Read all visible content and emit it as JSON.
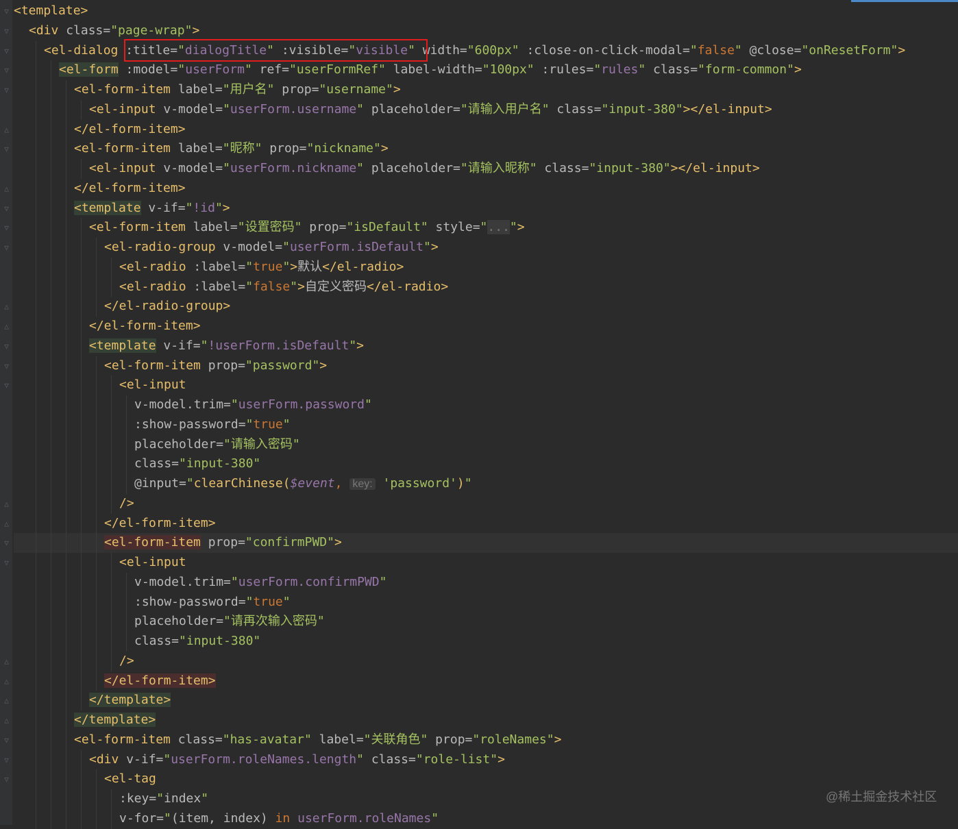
{
  "watermark": "@稀土掘金技术社区",
  "highlight_box_color": "#e01c1c",
  "current_line_index": 27,
  "lines": [
    {
      "indent": 0,
      "fold": "open",
      "tokens": [
        [
          "tag",
          "<template>"
        ]
      ]
    },
    {
      "indent": 1,
      "fold": "open",
      "tokens": [
        [
          "tag",
          "<div "
        ],
        [
          "attr",
          "class="
        ],
        [
          "str",
          "\"page-wrap\""
        ],
        [
          "tag",
          ">"
        ]
      ]
    },
    {
      "indent": 2,
      "fold": "open",
      "tokens": [
        [
          "tag",
          "<el-dialog "
        ],
        [
          "attr",
          ":title="
        ],
        [
          "str",
          "\""
        ],
        [
          "vexp",
          "dialogTitle"
        ],
        [
          "str",
          "\""
        ],
        [
          "attr",
          " :visible="
        ],
        [
          "str",
          "\""
        ],
        [
          "vexp",
          "visible"
        ],
        [
          "str",
          "\""
        ],
        [
          "attr",
          " width="
        ],
        [
          "str",
          "\"600px\""
        ],
        [
          "attr",
          " :close-on-click-modal="
        ],
        [
          "str",
          "\""
        ],
        [
          "kw",
          "false"
        ],
        [
          "str",
          "\""
        ],
        [
          "attr",
          " @close="
        ],
        [
          "str",
          "\"onResetForm\""
        ],
        [
          "tag",
          ">"
        ]
      ]
    },
    {
      "indent": 3,
      "fold": "open",
      "tokens": [
        [
          "tag hl-green",
          "<el-form"
        ],
        [
          "attr",
          " :model="
        ],
        [
          "str",
          "\""
        ],
        [
          "vexp",
          "userForm"
        ],
        [
          "str",
          "\""
        ],
        [
          "attr",
          " ref="
        ],
        [
          "str",
          "\"userFormRef\""
        ],
        [
          "attr",
          " label-width="
        ],
        [
          "str",
          "\"100px\""
        ],
        [
          "attr",
          " :rules="
        ],
        [
          "str",
          "\""
        ],
        [
          "vexp",
          "rules"
        ],
        [
          "str",
          "\""
        ],
        [
          "attr",
          " class="
        ],
        [
          "str",
          "\"form-common\""
        ],
        [
          "tag",
          ">"
        ]
      ]
    },
    {
      "indent": 4,
      "fold": "open",
      "tokens": [
        [
          "tag",
          "<el-form-item "
        ],
        [
          "attr",
          "label="
        ],
        [
          "str",
          "\""
        ],
        [
          "str cjk",
          "用户名"
        ],
        [
          "str",
          "\""
        ],
        [
          "attr",
          " prop="
        ],
        [
          "str",
          "\"username\""
        ],
        [
          "tag",
          ">"
        ]
      ]
    },
    {
      "indent": 5,
      "fold": "",
      "tokens": [
        [
          "tag",
          "<el-input "
        ],
        [
          "attr",
          "v-model="
        ],
        [
          "str",
          "\""
        ],
        [
          "vexp",
          "userForm.username"
        ],
        [
          "str",
          "\""
        ],
        [
          "attr",
          " placeholder="
        ],
        [
          "str",
          "\""
        ],
        [
          "str cjk",
          "请输入用户名"
        ],
        [
          "str",
          "\""
        ],
        [
          "attr",
          " class="
        ],
        [
          "str",
          "\"input-380\""
        ],
        [
          "tag",
          "></el-input>"
        ]
      ]
    },
    {
      "indent": 4,
      "fold": "close",
      "tokens": [
        [
          "tag",
          "</el-form-item>"
        ]
      ]
    },
    {
      "indent": 4,
      "fold": "open",
      "tokens": [
        [
          "tag",
          "<el-form-item "
        ],
        [
          "attr",
          "label="
        ],
        [
          "str",
          "\""
        ],
        [
          "str cjk",
          "昵称"
        ],
        [
          "str",
          "\""
        ],
        [
          "attr",
          " prop="
        ],
        [
          "str",
          "\"nickname\""
        ],
        [
          "tag",
          ">"
        ]
      ]
    },
    {
      "indent": 5,
      "fold": "",
      "tokens": [
        [
          "tag",
          "<el-input "
        ],
        [
          "attr",
          "v-model="
        ],
        [
          "str",
          "\""
        ],
        [
          "vexp",
          "userForm.nickname"
        ],
        [
          "str",
          "\""
        ],
        [
          "attr",
          " placeholder="
        ],
        [
          "str",
          "\""
        ],
        [
          "str cjk",
          "请输入昵称"
        ],
        [
          "str",
          "\""
        ],
        [
          "attr",
          " class="
        ],
        [
          "str",
          "\"input-380\""
        ],
        [
          "tag",
          "></el-input>"
        ]
      ]
    },
    {
      "indent": 4,
      "fold": "close",
      "tokens": [
        [
          "tag",
          "</el-form-item>"
        ]
      ]
    },
    {
      "indent": 4,
      "fold": "open",
      "tokens": [
        [
          "tag hl-green",
          "<template"
        ],
        [
          "attr",
          " v-if="
        ],
        [
          "str",
          "\""
        ],
        [
          "vexp",
          "!id"
        ],
        [
          "str",
          "\""
        ],
        [
          "tag",
          ">"
        ]
      ]
    },
    {
      "indent": 5,
      "fold": "open",
      "tokens": [
        [
          "tag",
          "<el-form-item "
        ],
        [
          "attr",
          "label="
        ],
        [
          "str",
          "\""
        ],
        [
          "str cjk",
          "设置密码"
        ],
        [
          "str",
          "\""
        ],
        [
          "attr",
          " prop="
        ],
        [
          "str",
          "\"isDefault\""
        ],
        [
          "attr",
          " style="
        ],
        [
          "str",
          "\""
        ],
        [
          "fold-dots",
          "..."
        ],
        [
          "str",
          "\""
        ],
        [
          "tag",
          ">"
        ]
      ]
    },
    {
      "indent": 6,
      "fold": "open",
      "tokens": [
        [
          "tag",
          "<el-radio-group "
        ],
        [
          "attr",
          "v-model="
        ],
        [
          "str",
          "\""
        ],
        [
          "vexp",
          "userForm.isDefault"
        ],
        [
          "str",
          "\""
        ],
        [
          "tag",
          ">"
        ]
      ]
    },
    {
      "indent": 7,
      "fold": "",
      "tokens": [
        [
          "tag",
          "<el-radio "
        ],
        [
          "attr",
          ":label="
        ],
        [
          "str",
          "\""
        ],
        [
          "kw",
          "true"
        ],
        [
          "str",
          "\""
        ],
        [
          "tag",
          ">"
        ],
        [
          "plain cjk",
          "默认"
        ],
        [
          "tag",
          "</el-radio>"
        ]
      ]
    },
    {
      "indent": 7,
      "fold": "",
      "tokens": [
        [
          "tag",
          "<el-radio "
        ],
        [
          "attr",
          ":label="
        ],
        [
          "str",
          "\""
        ],
        [
          "kw",
          "false"
        ],
        [
          "str",
          "\""
        ],
        [
          "tag",
          ">"
        ],
        [
          "plain cjk",
          "自定义密码"
        ],
        [
          "tag",
          "</el-radio>"
        ]
      ]
    },
    {
      "indent": 6,
      "fold": "close",
      "tokens": [
        [
          "tag",
          "</el-radio-group>"
        ]
      ]
    },
    {
      "indent": 5,
      "fold": "close",
      "tokens": [
        [
          "tag",
          "</el-form-item>"
        ]
      ]
    },
    {
      "indent": 5,
      "fold": "open",
      "tokens": [
        [
          "tag hl-green",
          "<template"
        ],
        [
          "attr",
          " v-if="
        ],
        [
          "str",
          "\""
        ],
        [
          "vexp",
          "!userForm.isDefault"
        ],
        [
          "str",
          "\""
        ],
        [
          "tag",
          ">"
        ]
      ]
    },
    {
      "indent": 6,
      "fold": "open",
      "tokens": [
        [
          "tag",
          "<el-form-item "
        ],
        [
          "attr",
          "prop="
        ],
        [
          "str",
          "\"password\""
        ],
        [
          "tag",
          ">"
        ]
      ]
    },
    {
      "indent": 7,
      "fold": "open",
      "tokens": [
        [
          "tag",
          "<el-input"
        ]
      ]
    },
    {
      "indent": 8,
      "fold": "",
      "tokens": [
        [
          "attr",
          "v-model.trim="
        ],
        [
          "str",
          "\""
        ],
        [
          "vexp",
          "userForm.password"
        ],
        [
          "str",
          "\""
        ]
      ]
    },
    {
      "indent": 8,
      "fold": "",
      "tokens": [
        [
          "attr",
          ":show-password="
        ],
        [
          "str",
          "\""
        ],
        [
          "kw",
          "true"
        ],
        [
          "str",
          "\""
        ]
      ]
    },
    {
      "indent": 8,
      "fold": "",
      "tokens": [
        [
          "attr",
          "placeholder="
        ],
        [
          "str",
          "\""
        ],
        [
          "str cjk",
          "请输入密码"
        ],
        [
          "str",
          "\""
        ]
      ]
    },
    {
      "indent": 8,
      "fold": "",
      "tokens": [
        [
          "attr",
          "class="
        ],
        [
          "str",
          "\"input-380\""
        ]
      ]
    },
    {
      "indent": 8,
      "fold": "",
      "tokens": [
        [
          "attr",
          "@input="
        ],
        [
          "str",
          "\""
        ],
        [
          "tag",
          "clearChinese("
        ],
        [
          "it",
          "$event"
        ],
        [
          "kw",
          ", "
        ],
        [
          "hint",
          "key:"
        ],
        [
          "plain",
          " "
        ],
        [
          "str",
          "'password'"
        ],
        [
          "tag",
          ")"
        ],
        [
          "str",
          "\""
        ]
      ]
    },
    {
      "indent": 7,
      "fold": "close",
      "tokens": [
        [
          "tag",
          "/>"
        ]
      ]
    },
    {
      "indent": 6,
      "fold": "close",
      "tokens": [
        [
          "tag",
          "</el-form-item>"
        ]
      ]
    },
    {
      "indent": 6,
      "fold": "open",
      "tokens": [
        [
          "tag hl-red",
          "<el-form-item"
        ],
        [
          "attr",
          " prop="
        ],
        [
          "str",
          "\"confirmPWD\""
        ],
        [
          "tag",
          ">"
        ]
      ]
    },
    {
      "indent": 7,
      "fold": "open",
      "tokens": [
        [
          "tag",
          "<el-input"
        ]
      ]
    },
    {
      "indent": 8,
      "fold": "",
      "tokens": [
        [
          "attr",
          "v-model.trim="
        ],
        [
          "str",
          "\""
        ],
        [
          "vexp",
          "userForm.confirmPWD"
        ],
        [
          "str",
          "\""
        ]
      ]
    },
    {
      "indent": 8,
      "fold": "",
      "tokens": [
        [
          "attr",
          ":show-password="
        ],
        [
          "str",
          "\""
        ],
        [
          "kw",
          "true"
        ],
        [
          "str",
          "\""
        ]
      ]
    },
    {
      "indent": 8,
      "fold": "",
      "tokens": [
        [
          "attr",
          "placeholder="
        ],
        [
          "str",
          "\""
        ],
        [
          "str cjk",
          "请再次输入密码"
        ],
        [
          "str",
          "\""
        ]
      ]
    },
    {
      "indent": 8,
      "fold": "",
      "tokens": [
        [
          "attr",
          "class="
        ],
        [
          "str",
          "\"input-380\""
        ]
      ]
    },
    {
      "indent": 7,
      "fold": "close",
      "tokens": [
        [
          "tag",
          "/>"
        ]
      ]
    },
    {
      "indent": 6,
      "fold": "close",
      "tokens": [
        [
          "tag hl-red",
          "</el-form-item>"
        ]
      ]
    },
    {
      "indent": 5,
      "fold": "close",
      "tokens": [
        [
          "tag hl-green",
          "</template>"
        ]
      ]
    },
    {
      "indent": 4,
      "fold": "close",
      "tokens": [
        [
          "tag hl-green",
          "</template>"
        ]
      ]
    },
    {
      "indent": 4,
      "fold": "open",
      "tokens": [
        [
          "tag",
          "<el-form-item "
        ],
        [
          "attr",
          "class="
        ],
        [
          "str",
          "\"has-avatar\""
        ],
        [
          "attr",
          " label="
        ],
        [
          "str",
          "\""
        ],
        [
          "str cjk",
          "关联角色"
        ],
        [
          "str",
          "\""
        ],
        [
          "attr",
          " prop="
        ],
        [
          "str",
          "\"roleNames\""
        ],
        [
          "tag",
          ">"
        ]
      ]
    },
    {
      "indent": 5,
      "fold": "open",
      "tokens": [
        [
          "tag",
          "<div "
        ],
        [
          "attr",
          "v-if="
        ],
        [
          "str",
          "\""
        ],
        [
          "vexp",
          "userForm.roleNames.length"
        ],
        [
          "str",
          "\""
        ],
        [
          "attr",
          " class="
        ],
        [
          "str",
          "\"role-list\""
        ],
        [
          "tag",
          ">"
        ]
      ]
    },
    {
      "indent": 6,
      "fold": "open",
      "tokens": [
        [
          "tag",
          "<el-tag"
        ]
      ]
    },
    {
      "indent": 7,
      "fold": "",
      "tokens": [
        [
          "attr",
          ":key="
        ],
        [
          "str",
          "\""
        ],
        [
          "plain",
          "index"
        ],
        [
          "str",
          "\""
        ]
      ]
    },
    {
      "indent": 7,
      "fold": "",
      "tokens": [
        [
          "attr",
          "v-for="
        ],
        [
          "str",
          "\""
        ],
        [
          "plain",
          "(item, index) "
        ],
        [
          "kw",
          "in "
        ],
        [
          "vexp",
          "userForm.roleNames"
        ],
        [
          "str",
          "\""
        ]
      ]
    }
  ]
}
